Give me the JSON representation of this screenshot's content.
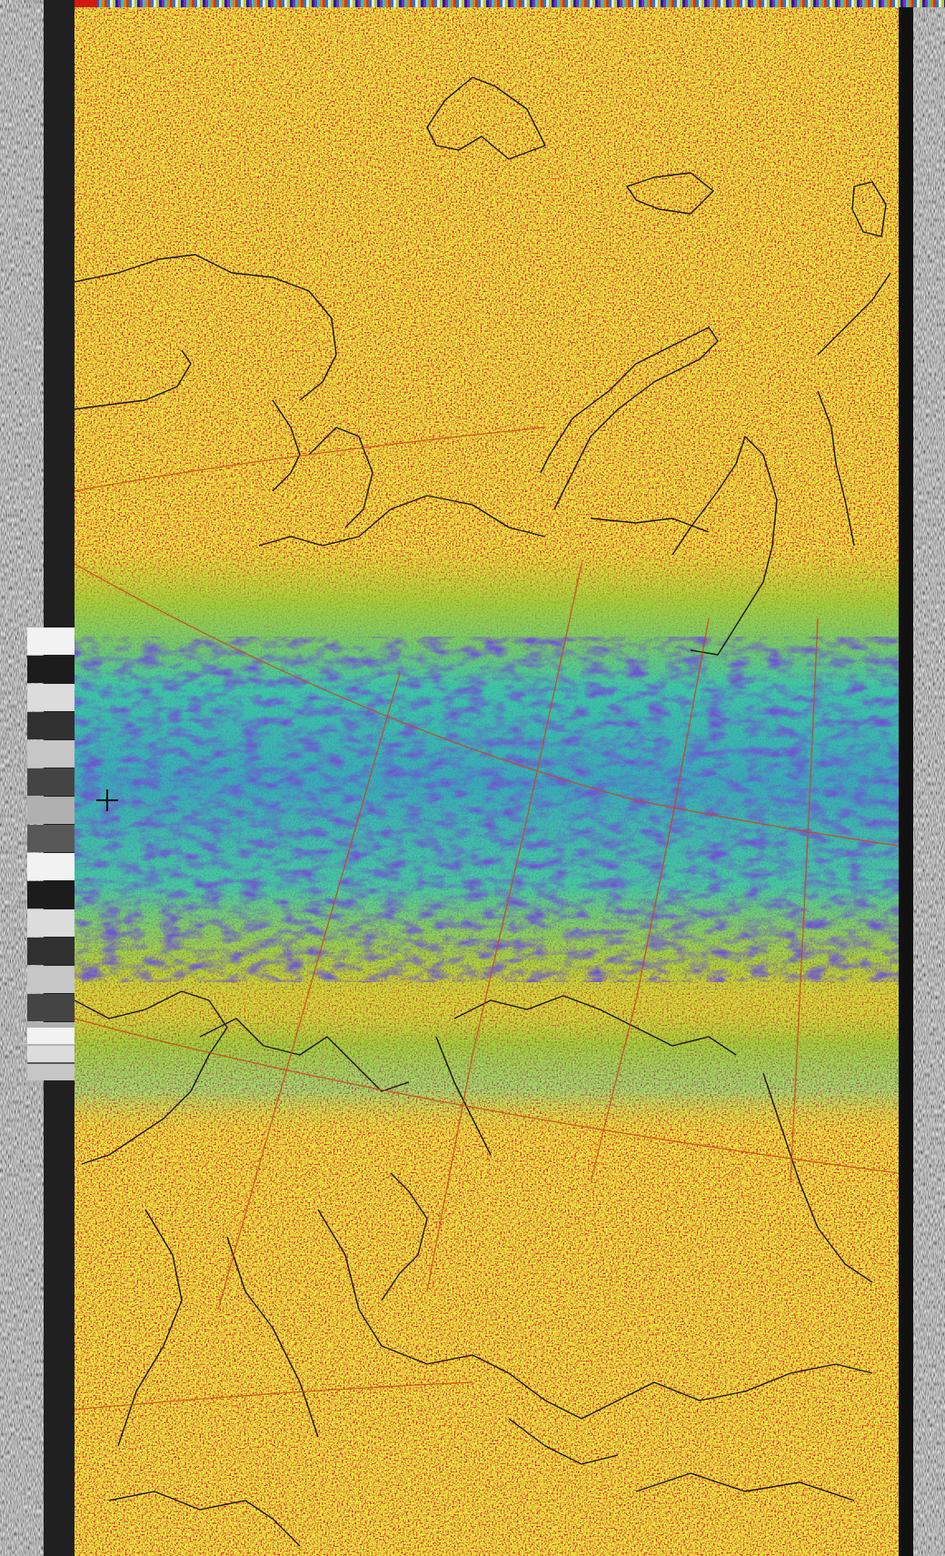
{
  "image": {
    "kind": "NOAA APT satellite image, false-colour thermal enhancement",
    "palette": {
      "warm_red": "#d23a12",
      "orange": "#e07a1c",
      "yellow_green": "#b8c82a",
      "green": "#6cc23a",
      "cyan": "#2cc6b4",
      "blue": "#1f7fd0",
      "indigo": "#2a1aa8",
      "telemetry_gray": "#8a8a8a",
      "sync_dark": "#151515",
      "coast": "#1a1208",
      "grid": "#c8461a"
    },
    "features": [
      "left-sync-noise-strip",
      "space-view-wedge",
      "main-colour-frame",
      "right-telemetry-strip",
      "top-colour-scale-strip",
      "cloud-band",
      "coastlines",
      "lat-lon-grid",
      "cross-marker"
    ]
  }
}
